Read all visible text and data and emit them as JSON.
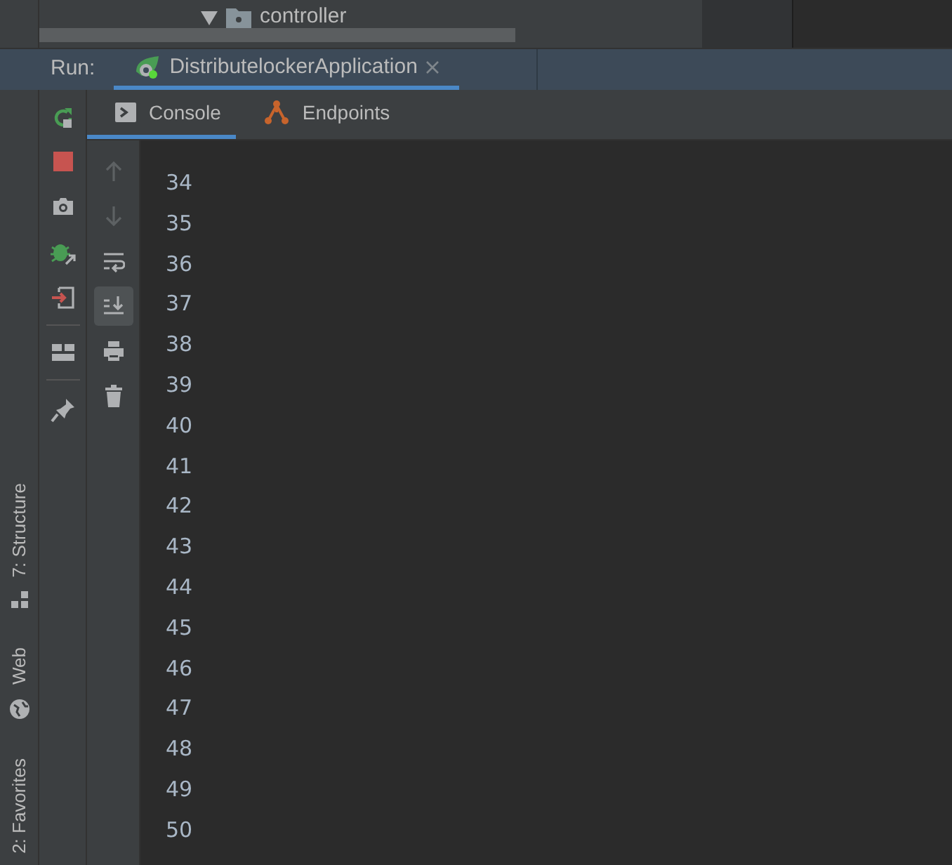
{
  "project_tree": {
    "expanded": true,
    "label": "controller"
  },
  "run_panel": {
    "label": "Run:",
    "tabs": [
      {
        "label": "DistributelockerApplication",
        "selected": true
      }
    ]
  },
  "console_tabs": [
    {
      "kind": "console",
      "label": "Console",
      "selected": true
    },
    {
      "kind": "endpoints",
      "label": "Endpoints",
      "selected": false
    }
  ],
  "console_toolbar": [
    {
      "kind": "up",
      "disabled": true
    },
    {
      "kind": "down",
      "disabled": true
    },
    {
      "kind": "wrap",
      "selected": false
    },
    {
      "kind": "scroll-end",
      "selected": true
    },
    {
      "kind": "print",
      "selected": false
    },
    {
      "kind": "clear",
      "selected": false
    }
  ],
  "console_lines": [
    "34",
    "35",
    "36",
    "37",
    "38",
    "39",
    "40",
    "41",
    "42",
    "43",
    "44",
    "45",
    "46",
    "47",
    "48",
    "49",
    "50"
  ],
  "side_stripe": [
    {
      "kind": "structure",
      "label": "7: Structure"
    },
    {
      "kind": "web",
      "label": "Web"
    },
    {
      "kind": "favorites",
      "label": "2: Favorites"
    }
  ]
}
